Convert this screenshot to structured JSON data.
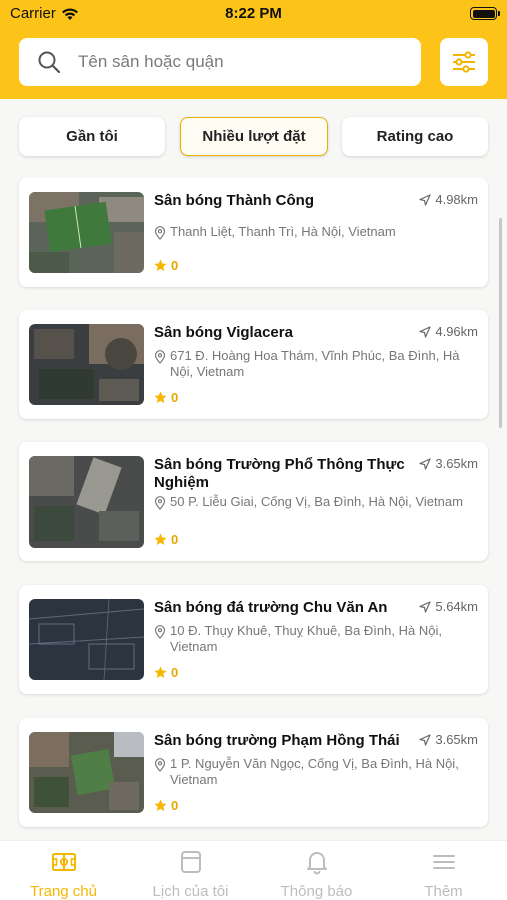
{
  "status_bar": {
    "carrier": "Carrier",
    "time": "8:22 PM"
  },
  "search": {
    "placeholder": "Tên sân hoặc quận",
    "value": ""
  },
  "filters": [
    {
      "label": "Gần tôi",
      "active": false
    },
    {
      "label": "Nhiều lượt đặt",
      "active": true
    },
    {
      "label": "Rating cao",
      "active": false
    }
  ],
  "fields": [
    {
      "name": "Sân bóng Thành Công",
      "distance": "4.98km",
      "address": "Thanh Liệt, Thanh Trì, Hà Nội, Vietnam",
      "rating": "0"
    },
    {
      "name": "Sân bóng Viglacera",
      "distance": "4.96km",
      "address": "671 Đ. Hoàng Hoa Thám, Vĩnh Phúc, Ba Đình, Hà Nội, Vietnam",
      "rating": "0"
    },
    {
      "name": "Sân bóng Trường Phổ Thông Thực Nghiệm",
      "distance": "3.65km",
      "address": "50 P. Liễu Giai, Cống Vị, Ba Đình, Hà Nội, Vietnam",
      "rating": "0"
    },
    {
      "name": "Sân bóng đá trường Chu Văn An",
      "distance": "5.64km",
      "address": "10 Đ. Thụy Khuê, Thuỵ Khuê, Ba Đình, Hà Nội, Vietnam",
      "rating": "0"
    },
    {
      "name": "Sân bóng trường Phạm Hồng Thái",
      "distance": "3.65km",
      "address": "1 P. Nguyễn Văn Ngọc, Cống Vị, Ba Đình, Hà Nội, Vietnam",
      "rating": "0"
    }
  ],
  "tabs": [
    {
      "label": "Trang chủ",
      "icon": "field-icon",
      "active": true
    },
    {
      "label": "Lịch của tôi",
      "icon": "calendar-icon",
      "active": false
    },
    {
      "label": "Thông báo",
      "icon": "bell-icon",
      "active": false
    },
    {
      "label": "Thêm",
      "icon": "menu-icon",
      "active": false
    }
  ],
  "colors": {
    "accent": "#fcc419",
    "active_tab": "#f5b700",
    "rating_star": "#f5b700"
  }
}
